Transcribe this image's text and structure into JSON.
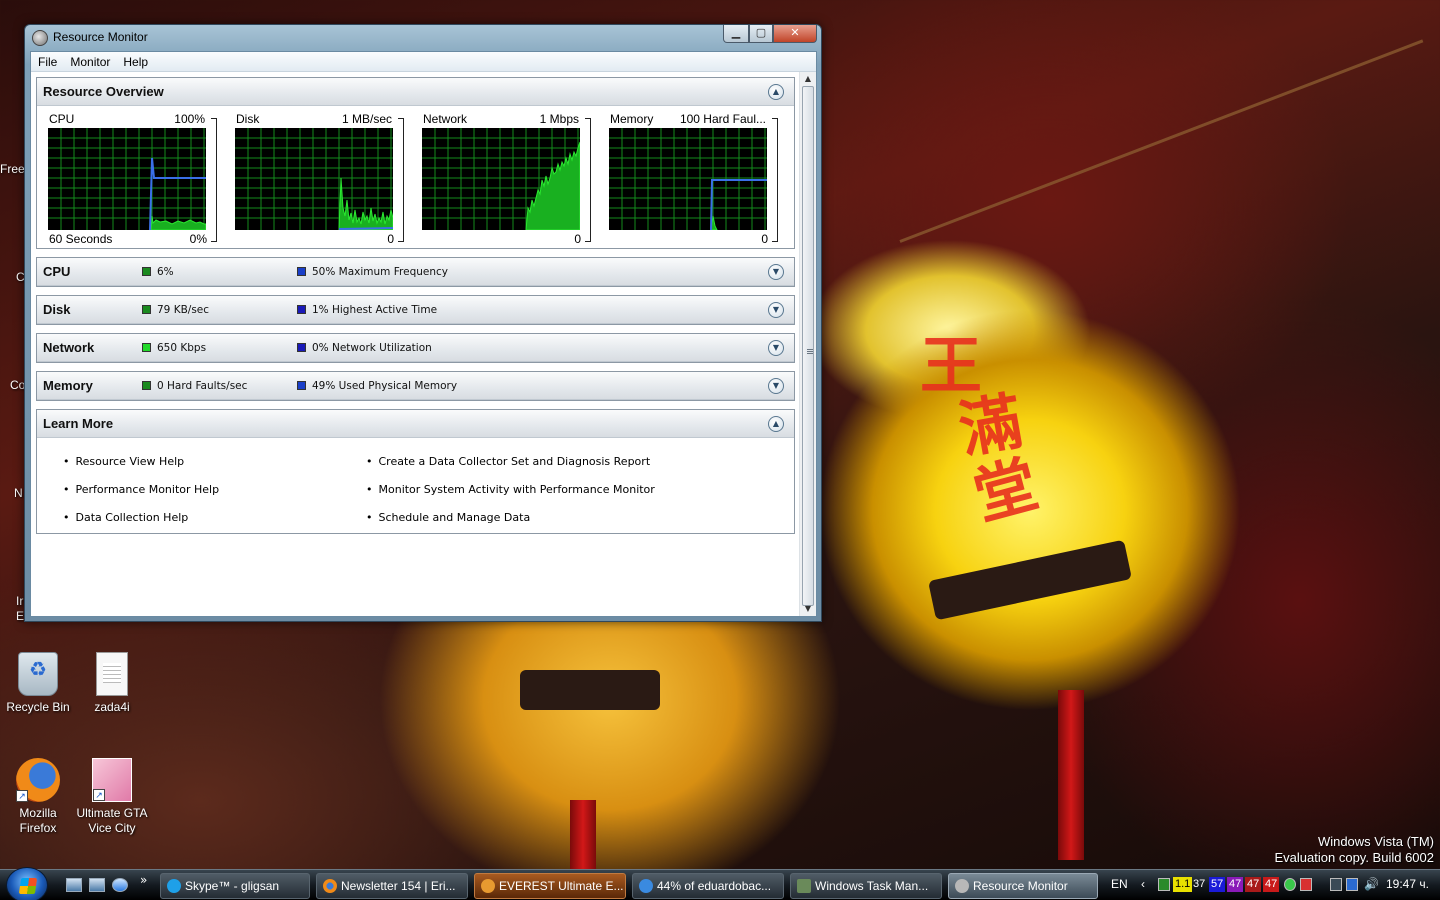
{
  "window": {
    "title": "Resource Monitor",
    "menu": [
      "File",
      "Monitor",
      "Help"
    ],
    "buttons": {
      "minimize": "▁",
      "maximize": "▢",
      "close": "✕"
    }
  },
  "overview": {
    "title": "Resource Overview",
    "graphs": [
      {
        "id": "cpu",
        "label": "CPU",
        "max": "100%",
        "time": "60 Seconds",
        "min": "0%"
      },
      {
        "id": "disk",
        "label": "Disk",
        "max": "1 MB/sec",
        "time": "",
        "min": "0"
      },
      {
        "id": "network",
        "label": "Network",
        "max": "1 Mbps",
        "time": "",
        "min": "0"
      },
      {
        "id": "memory",
        "label": "Memory",
        "max": "100 Hard Faul...",
        "time": "",
        "min": "0"
      }
    ]
  },
  "sections": [
    {
      "title": "CPU",
      "stat1": "6%",
      "stat2": "50% Maximum Frequency"
    },
    {
      "title": "Disk",
      "stat1": "79 KB/sec",
      "stat2": "1% Highest Active Time"
    },
    {
      "title": "Network",
      "stat1": "650 Kbps",
      "stat2": "0% Network Utilization"
    },
    {
      "title": "Memory",
      "stat1": "0 Hard Faults/sec",
      "stat2": "49% Used Physical Memory"
    }
  ],
  "learn_more": {
    "title": "Learn More",
    "left": [
      "Resource View Help",
      "Performance Monitor Help",
      "Data Collection Help"
    ],
    "right": [
      "Create a Data Collector Set and Diagnosis Report",
      "Monitor System Activity with Performance Monitor",
      "Schedule and Manage Data"
    ]
  },
  "desktop": {
    "icons": [
      "Recycle Bin",
      "zada4i",
      "Mozilla Firefox",
      "Ultimate GTA Vice City"
    ],
    "partial": [
      "Free",
      "C",
      "Co",
      "N",
      "Ir",
      "E"
    ],
    "watermark": [
      "Windows Vista (TM)",
      "Evaluation copy. Build 6002"
    ]
  },
  "taskbar": {
    "tasks": [
      "Skype™ - gligsan",
      "Newsletter 154 | Eri...",
      "EVEREST Ultimate E...",
      "44% of eduardobac...",
      "Windows Task Man...",
      "Resource Monitor"
    ],
    "language": "EN",
    "tray_numbers": [
      "1.1",
      "37",
      "57",
      "47",
      "47",
      "47"
    ],
    "clock": "19:47 ч."
  },
  "colors": {
    "graph_bg": "#000000",
    "graph_grid": "#138a1d",
    "graph_green": "#22d92a",
    "graph_blue": "#3a6fe8"
  }
}
